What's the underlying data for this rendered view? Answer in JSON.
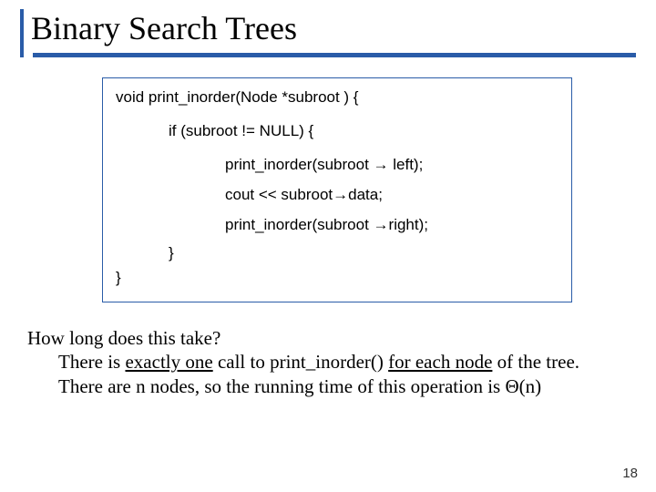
{
  "title": "Binary Search Trees",
  "code": {
    "sig": "void print_inorder(Node *subroot ) {",
    "cond": "if (subroot != NULL) {",
    "call_left_a": "print_inorder(subroot ",
    "call_left_b": " left);",
    "cout_a": "cout << subroot",
    "cout_b": "data;",
    "call_right_a": "print_inorder(subroot ",
    "call_right_b": "right);",
    "close_inner": "}",
    "close_outer": "}",
    "arrow": "→"
  },
  "body": {
    "q": "How long does this take?",
    "p1_a": "There is ",
    "p1_u1": "exactly one",
    "p1_b": " call to print_inorder() ",
    "p1_u2": "for each node",
    "p1_c": " of the tree.",
    "p2_a": "There are n nodes, so the running time of this operation is ",
    "p2_b": "(n)",
    "theta": "Θ"
  },
  "page": "18"
}
